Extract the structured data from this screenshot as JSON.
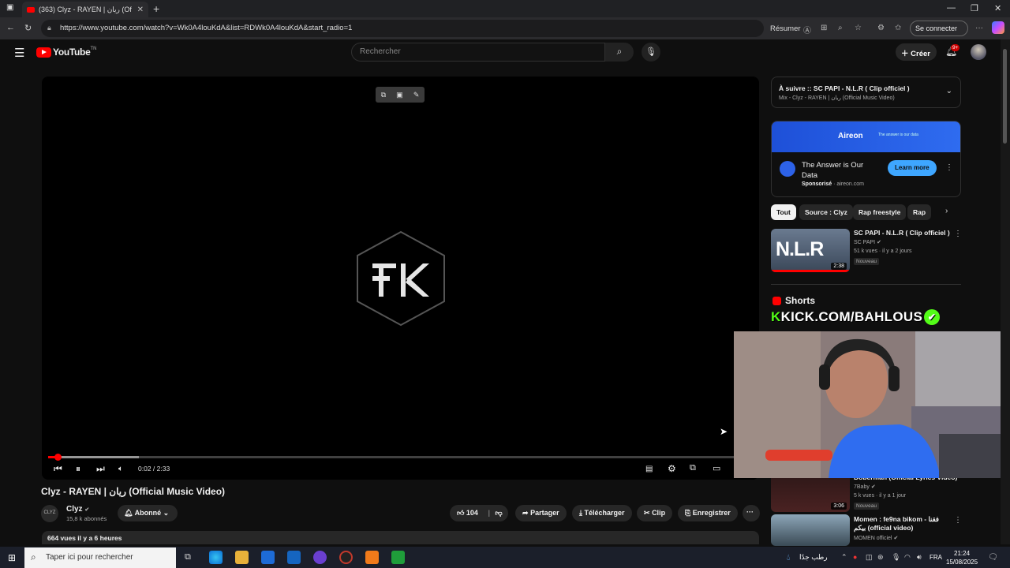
{
  "browser": {
    "tab_title": "(363) Clyz - RAYEN | ريان (Of",
    "tab_close": "✕",
    "new_tab": "+",
    "url": "https://www.youtube.com/watch?v=Wk0A4louKdA&list=RDWk0A4louKdA&start_radio=1",
    "resume_label": "Résumer",
    "signin_label": "Se connecter",
    "menu_dots": "···"
  },
  "youtube": {
    "logo_text": "YouTube",
    "logo_tm": "TN",
    "search_placeholder": "Rechercher",
    "create_label": "Créer",
    "notif_badge": "9+"
  },
  "player": {
    "time": "0:02 / 2:33",
    "progress_fraction": 0.013,
    "buffered_fraction": 0.128
  },
  "video": {
    "title": "Clyz - RAYEN | ريان (Official Music Video)",
    "channel_name": "Clyz",
    "channel_subs": "15,8 k abonnés",
    "channel_avatar_text": "CLYZ",
    "subscribed_label": "Abonné",
    "likes": "104",
    "share_label": "Partager",
    "download_label": "Télécharger",
    "clip_label": "Clip",
    "save_label": "Enregistrer",
    "desc_meta": "664 vues  il y a 6 heures"
  },
  "sidebar": {
    "upnext_title": "À suivre :: SC PAPI - N.L.R ( Clip officiel )",
    "upnext_sub": "Mix - Clyz - RAYEN | ريان (Official Music Video)",
    "ad": {
      "brand": "Aireon",
      "tagline": "The answer is our data",
      "title": "The Answer is Our Data",
      "sponsored": "Sponsorisé",
      "domain": "aireon.com",
      "cta": "Learn more"
    },
    "chips": [
      "Tout",
      "Source : Clyz",
      "Rap freestyle",
      "Rap"
    ],
    "videos": [
      {
        "title": "SC PAPI - N.L.R ( Clip officiel )",
        "channel": "SC PAPI",
        "meta": "51 k vues · il y a 2 jours",
        "badge": "Nouveau",
        "duration": "2:38",
        "thumb_text": "N.L.R"
      },
      {
        "title": "Doberman (Official Lyrics Video)",
        "channel": "",
        "meta": "5 k vues · il y a 1 jour",
        "badge": "Nouveau",
        "duration": "3:06",
        "thumb_text": ""
      },
      {
        "title": "Momen : fe9na bikom - فقنا بيكم (official video)",
        "channel": "MOMEN officiel",
        "meta": "",
        "badge": "",
        "duration": "",
        "thumb_text": ""
      }
    ],
    "second_channel": "7Baby",
    "shorts_label": "Shorts",
    "overlay_kick": "KICK.COM/BAHLOUS"
  },
  "taskbar": {
    "search_placeholder": "Taper ici pour rechercher",
    "weather": "رطب جدًا",
    "lang": "FRA",
    "time": "21:24",
    "date": "15/08/2025"
  }
}
